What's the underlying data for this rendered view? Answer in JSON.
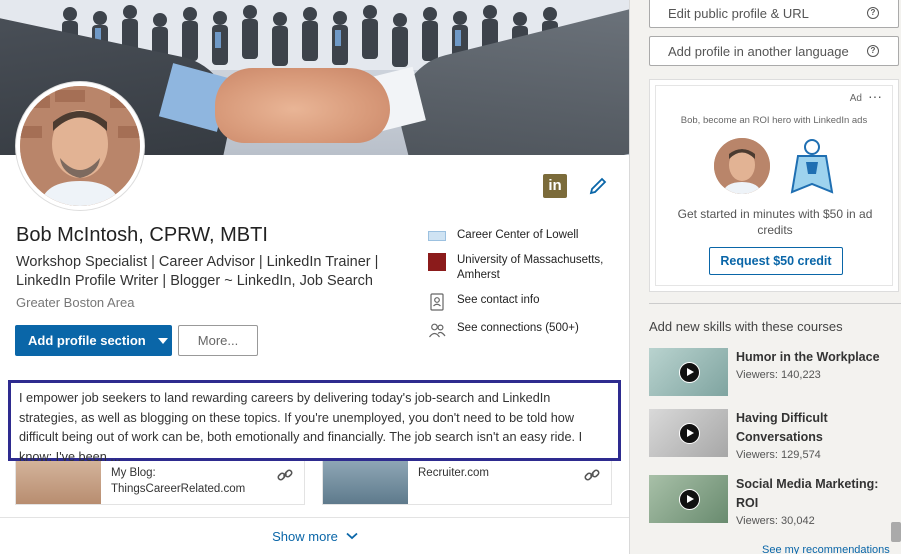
{
  "profile": {
    "name": "Bob McIntosh, CPRW, MBTI",
    "headline": "Workshop Specialist | Career Advisor | LinkedIn Trainer | LinkedIn Profile Writer | Blogger ~ LinkedIn, Job Search",
    "location": "Greater Boston Area",
    "linkedin_icon": "in",
    "add_section_label": "Add profile section",
    "more_label": "More...",
    "side": {
      "current": "Career Center of Lowell",
      "education": "University of Massachusetts, Amherst",
      "contact": "See contact info",
      "connections": "See connections (500+)"
    },
    "summary": "I empower job seekers to land rewarding careers by delivering today's job-search and LinkedIn strategies, as well as blogging on these topics. If you're unemployed, you don't need to be told how difficult being out of work can be, both emotionally and financially. The job search isn't an easy ride. I know; I've been ...",
    "media": [
      {
        "title": "My Blog: ThingsCareerRelated.com"
      },
      {
        "title": "Recruiter.com"
      }
    ],
    "show_more": "Show more"
  },
  "rail": {
    "edit_public_profile": "Edit public profile & URL",
    "add_language": "Add profile in another language",
    "help_glyph": "?",
    "ad": {
      "label": "Ad",
      "menu": "···",
      "tagline": "Bob, become an ROI hero with LinkedIn ads",
      "description": "Get started in minutes with $50 in ad credits",
      "cta": "Request $50 credit"
    },
    "courses_title": "Add new skills with these courses",
    "courses": [
      {
        "title": "Humor in the Workplace",
        "viewers": "Viewers: 140,223"
      },
      {
        "title": "Having Difficult Conversations",
        "viewers": "Viewers: 129,574"
      },
      {
        "title": "Social Media Marketing: ROI",
        "viewers": "Viewers: 30,042"
      }
    ],
    "footer_link": "See my recommendations"
  },
  "colors": {
    "brand": "#0a66a8",
    "highlight_border": "#2e2b8f",
    "linkedin_badge": "#7b6b3a"
  }
}
